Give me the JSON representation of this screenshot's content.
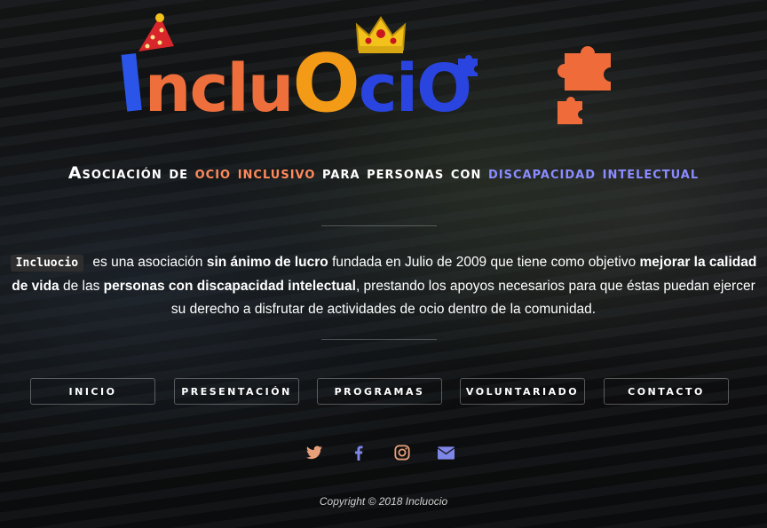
{
  "logo": {
    "text": "IncluOcio",
    "letters": [
      "I",
      "n",
      "c",
      "l",
      "u",
      "O",
      "c",
      "i",
      "O"
    ]
  },
  "tagline": {
    "part1": "Asociación de ",
    "part2": "ocio inclusivo",
    "part3": " para personas con ",
    "part4": "discapacidad intelectual"
  },
  "description": {
    "brand": "Incluocio",
    "t1": " es una asociación ",
    "b1": "sin ánimo de lucro",
    "t2": " fundada en Julio de 2009 que tiene como objetivo ",
    "b2": "mejorar la calidad de vida",
    "t3": " de las ",
    "b3": "personas con discapacidad intelectual",
    "t4": ", prestando los apoyos necesarios para que éstas puedan ejercer su derecho a disfrutar de actividades de ocio dentro de la comunidad."
  },
  "nav": {
    "items": [
      "INICIO",
      "PRESENTACIÓN",
      "PROGRAMAS",
      "VOLUNTARIADO",
      "CONTACTO"
    ]
  },
  "social": {
    "icons": [
      "twitter-icon",
      "facebook-icon",
      "instagram-icon",
      "envelope-icon"
    ],
    "color": "#e8a07a",
    "blue": "#7e86e8"
  },
  "footer": {
    "copyright": "Copyright © 2018 Incluocio"
  },
  "colors": {
    "orange": "#ff8a5c",
    "blue": "#8a8cff",
    "logo_orange": "#ee6f3c",
    "logo_blue": "#2a44e0",
    "logo_yellow": "#f39a16"
  }
}
